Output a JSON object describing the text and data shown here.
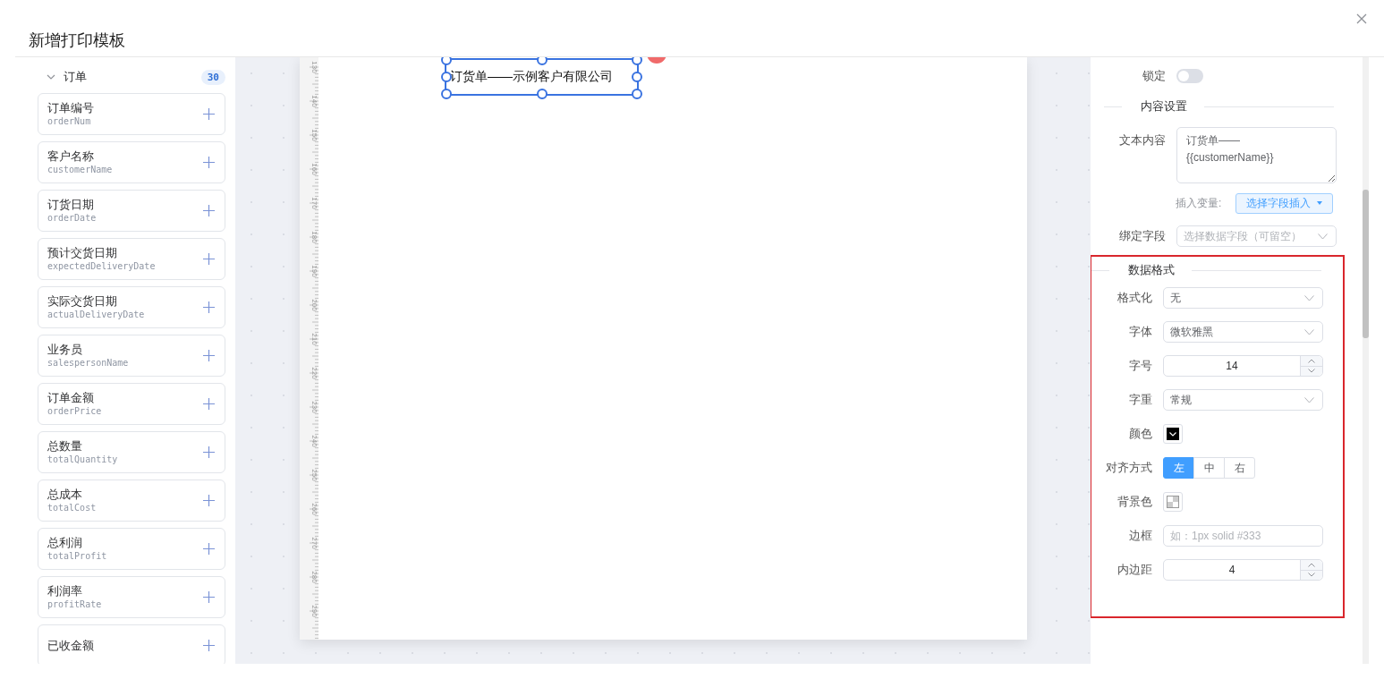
{
  "dialog": {
    "title": "新增打印模板"
  },
  "field_panel": {
    "group": {
      "label": "订单",
      "count": "30",
      "expanded": true
    },
    "fields": [
      {
        "label": "订单编号",
        "key": "orderNum"
      },
      {
        "label": "客户名称",
        "key": "customerName"
      },
      {
        "label": "订货日期",
        "key": "orderDate"
      },
      {
        "label": "预计交货日期",
        "key": "expectedDeliveryDate"
      },
      {
        "label": "实际交货日期",
        "key": "actualDeliveryDate"
      },
      {
        "label": "业务员",
        "key": "salespersonName"
      },
      {
        "label": "订单金额",
        "key": "orderPrice"
      },
      {
        "label": "总数量",
        "key": "totalQuantity"
      },
      {
        "label": "总成本",
        "key": "totalCost"
      },
      {
        "label": "总利润",
        "key": "totalProfit"
      },
      {
        "label": "利润率",
        "key": "profitRate"
      },
      {
        "label": "已收金额"
      }
    ]
  },
  "canvas": {
    "ruler_labels": [
      "130",
      "140",
      "150",
      "160",
      "170",
      "180",
      "190",
      "200",
      "210",
      "220",
      "230",
      "240",
      "250",
      "260",
      "270",
      "280",
      "290"
    ],
    "element": {
      "text": "订货单——示例客户有限公司",
      "selected": true
    }
  },
  "properties": {
    "lock": {
      "label": "锁定",
      "on": false
    },
    "content_section": {
      "title": "内容设置",
      "text_content": {
        "label": "文本内容",
        "value": "订货单——\n{{customerName}}"
      },
      "insert_variable": {
        "label": "插入变量:",
        "button": "选择字段插入"
      },
      "bind_field": {
        "label": "绑定字段",
        "placeholder": "选择数据字段（可留空）"
      }
    },
    "format_section": {
      "title": "数据格式",
      "highlighted": true,
      "rows": [
        {
          "kind": "select",
          "label": "格式化",
          "value": "无"
        },
        {
          "kind": "select",
          "label": "字体",
          "value": "微软雅黑"
        },
        {
          "kind": "number",
          "label": "字号",
          "value": "14"
        },
        {
          "kind": "select",
          "label": "字重",
          "value": "常规"
        },
        {
          "kind": "color",
          "label": "颜色",
          "color": "#000000"
        },
        {
          "kind": "segmented",
          "label": "对齐方式",
          "options": [
            {
              "label": "左",
              "selected": true
            },
            {
              "label": "中",
              "selected": false
            },
            {
              "label": "右",
              "selected": false
            }
          ]
        },
        {
          "kind": "color",
          "label": "背景色"
        },
        {
          "kind": "text",
          "label": "边框",
          "placeholder": "如：1px solid #333"
        },
        {
          "kind": "number",
          "label": "内边距",
          "value": "4"
        }
      ]
    }
  }
}
